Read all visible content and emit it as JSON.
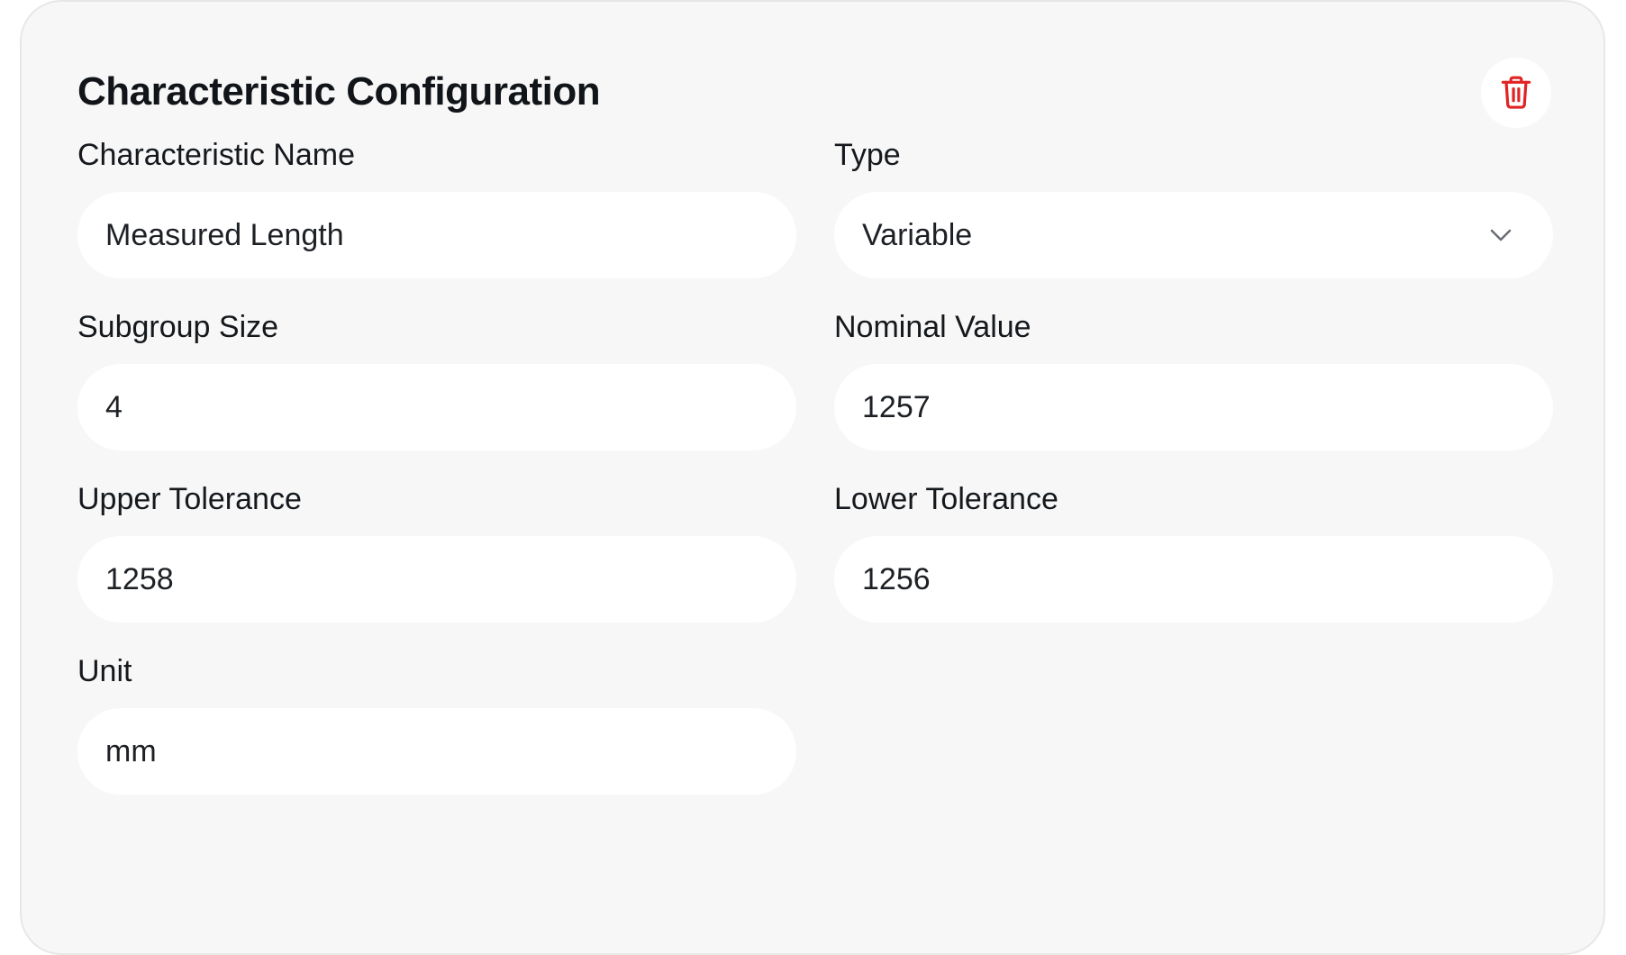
{
  "header": {
    "title": "Characteristic Configuration",
    "delete_icon": "trash-icon"
  },
  "fields": {
    "name": {
      "label": "Characteristic Name",
      "value": "Measured Length"
    },
    "type": {
      "label": "Type",
      "value": "Variable",
      "icon": "chevron-down-icon"
    },
    "subgroup_size": {
      "label": "Subgroup Size",
      "value": "4"
    },
    "nominal_value": {
      "label": "Nominal Value",
      "value": "1257"
    },
    "upper_tolerance": {
      "label": "Upper Tolerance",
      "value": "1258"
    },
    "lower_tolerance": {
      "label": "Lower Tolerance",
      "value": "1256"
    },
    "unit": {
      "label": "Unit",
      "value": "mm"
    }
  },
  "colors": {
    "card_background": "#f6f7f6",
    "field_background": "#ffffff",
    "delete_icon": "#e02424",
    "text": "#15181c"
  }
}
